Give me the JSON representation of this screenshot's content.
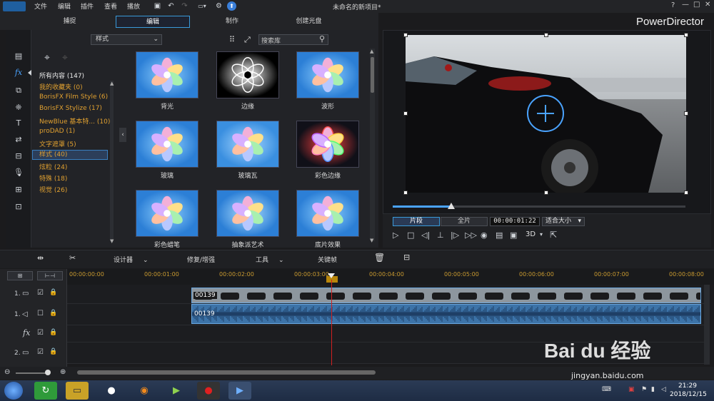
{
  "app": {
    "title": "未命名的新项目*",
    "brand": "PowerDirector"
  },
  "menu": [
    "文件",
    "编辑",
    "插件",
    "查看",
    "播放"
  ],
  "window_controls": {
    "help": "?",
    "minimize": "—",
    "maximize": "□",
    "close": "✕"
  },
  "mode_tabs": [
    "捕捉",
    "编辑",
    "制作",
    "创建光盘"
  ],
  "library": {
    "dropdown_value": "样式",
    "search_placeholder": "搜索库",
    "categories": [
      {
        "label": "所有内容 (147)"
      },
      {
        "label": "我的收藏夹  (0)"
      },
      {
        "label": "BorisFX Film Style  (6)"
      },
      {
        "label": "BorisFX Stylize  (17)"
      },
      {
        "label": "NewBlue 基本特...  (10)"
      },
      {
        "label": "proDAD  (1)"
      },
      {
        "label": "文字遮罩  (5)"
      },
      {
        "label": "样式  (40)"
      },
      {
        "label": "炫粒  (24)"
      },
      {
        "label": "特殊  (18)"
      },
      {
        "label": "视觉  (26)"
      }
    ],
    "thumbnails": [
      {
        "label": "背光"
      },
      {
        "label": "边缘"
      },
      {
        "label": "波形"
      },
      {
        "label": "玻璃"
      },
      {
        "label": "玻璃瓦"
      },
      {
        "label": "彩色边缘"
      },
      {
        "label": "彩色蜡笔"
      },
      {
        "label": "抽象派艺术"
      },
      {
        "label": "底片效果"
      }
    ]
  },
  "preview": {
    "mode_clip": "片段",
    "mode_movie": "全片",
    "timecode": "00:00:01:22",
    "fit": "适合大小",
    "stereo": "3D",
    "progress": 0.2
  },
  "edit_toolbar": {
    "designer": "设计器",
    "repair": "修复/增强",
    "tools": "工具",
    "keyframe": "关键帧"
  },
  "ruler_ticks": [
    "00:00:00:00",
    "00:00:01:00",
    "00:00:02:00",
    "00:00:03:00",
    "00:00:04:00",
    "00:00:05:00",
    "00:00:06:00",
    "00:00:07:00",
    "00:00:08:00"
  ],
  "tracks": [
    {
      "label": "1."
    },
    {
      "label": "1."
    },
    {
      "label": "fx"
    },
    {
      "label": "2."
    }
  ],
  "clips": {
    "video_label": "00139",
    "audio_label": "00139"
  },
  "taskbar": {
    "time": "21:29",
    "date": "2018/12/15"
  },
  "watermark": {
    "brand": "Bai du 经验",
    "url": "jingyan.baidu.com"
  },
  "colors": {
    "accent": "#3a9ad9",
    "category": "#e0a030",
    "clip": "#4f86b8"
  }
}
